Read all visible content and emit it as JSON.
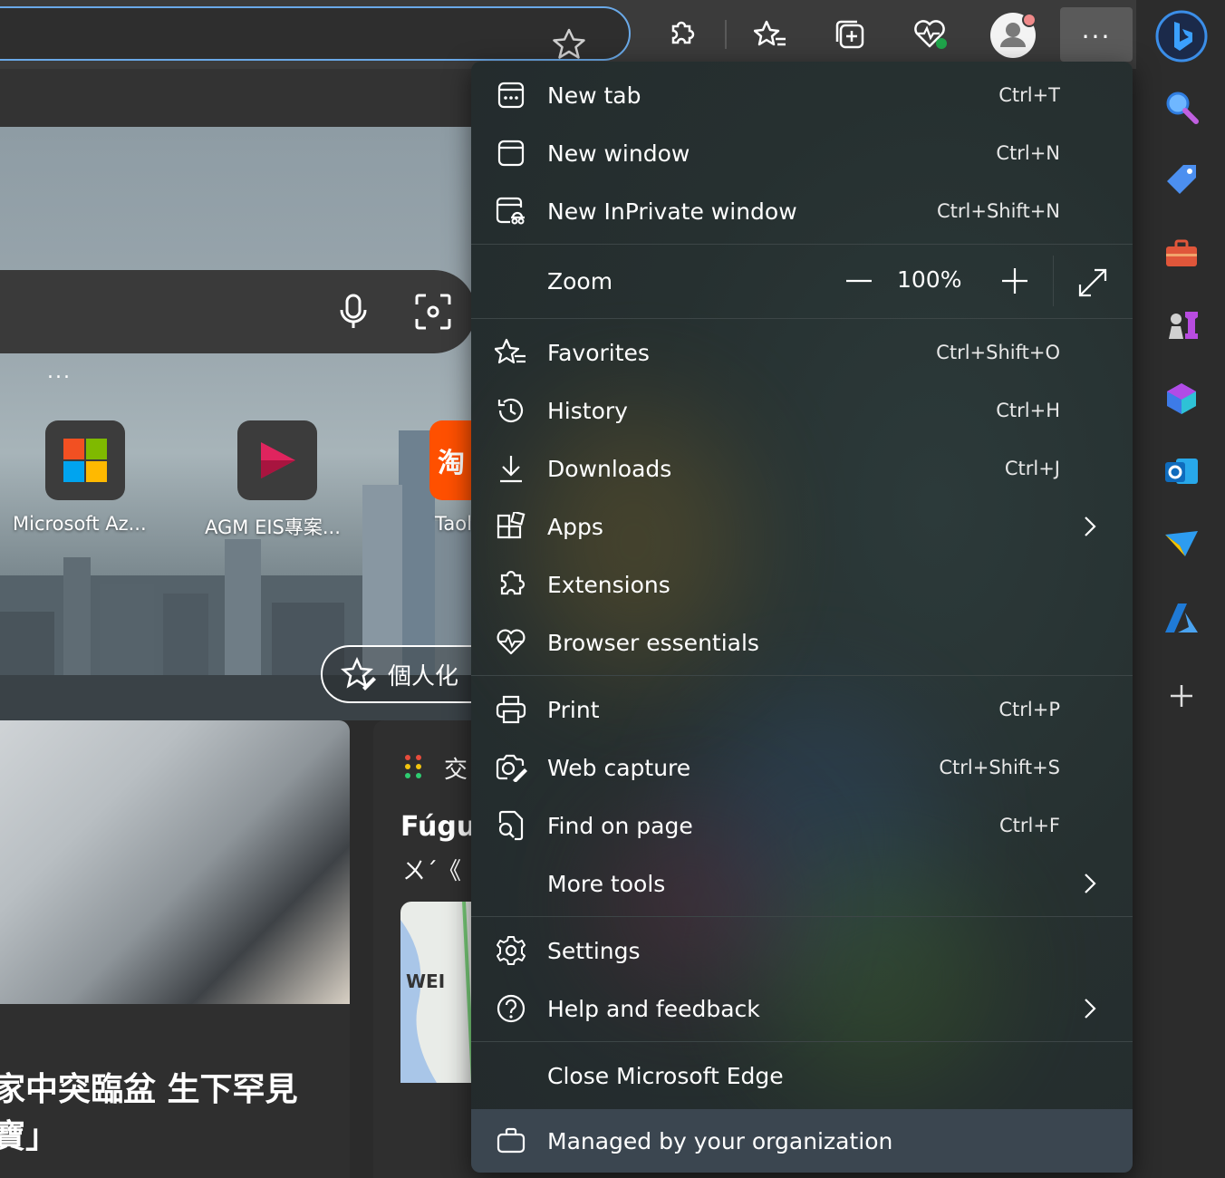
{
  "toolbar": {
    "more_label": "..."
  },
  "page": {
    "more_dots": "...",
    "tiles": [
      {
        "label": "Microsoft Az..."
      },
      {
        "label": "AGM EIS專案..."
      },
      {
        "label": "Taol",
        "icon_text": "淘"
      }
    ],
    "personalize_label": "個人化",
    "news_title_line1": "家中突臨盆 生下罕見",
    "news_title_line2": "寶」",
    "traffic_label": "交",
    "traffic_heading": "Fúgu",
    "traffic_sub": "ㄨˊ《",
    "map_label": "WEI"
  },
  "menu": {
    "new_tab": {
      "label": "New tab",
      "shortcut": "Ctrl+T"
    },
    "new_window": {
      "label": "New window",
      "shortcut": "Ctrl+N"
    },
    "new_inprivate": {
      "label": "New InPrivate window",
      "shortcut": "Ctrl+Shift+N"
    },
    "zoom": {
      "label": "Zoom",
      "value": "100%"
    },
    "favorites": {
      "label": "Favorites",
      "shortcut": "Ctrl+Shift+O"
    },
    "history": {
      "label": "History",
      "shortcut": "Ctrl+H"
    },
    "downloads": {
      "label": "Downloads",
      "shortcut": "Ctrl+J"
    },
    "apps": {
      "label": "Apps"
    },
    "extensions": {
      "label": "Extensions"
    },
    "browser_essentials": {
      "label": "Browser essentials"
    },
    "print": {
      "label": "Print",
      "shortcut": "Ctrl+P"
    },
    "web_capture": {
      "label": "Web capture",
      "shortcut": "Ctrl+Shift+S"
    },
    "find_on_page": {
      "label": "Find on page",
      "shortcut": "Ctrl+F"
    },
    "more_tools": {
      "label": "More tools"
    },
    "settings": {
      "label": "Settings"
    },
    "help_feedback": {
      "label": "Help and feedback"
    },
    "close_edge": {
      "label": "Close Microsoft Edge"
    },
    "managed": {
      "label": "Managed by your organization"
    }
  },
  "colors": {
    "menu_bg": "#263030",
    "accent_blue": "#6aa9e8",
    "managed_bg": "#3b4650"
  }
}
